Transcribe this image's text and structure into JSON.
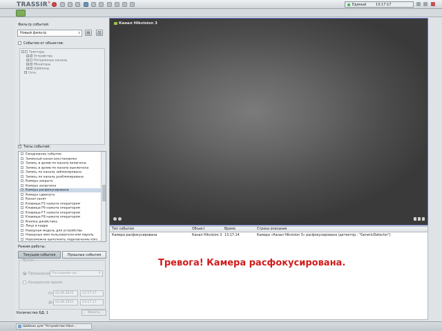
{
  "app": {
    "logo": "TRASSIR",
    "logo_mark": "®"
  },
  "topbar": {
    "status_label": "Единый",
    "time": "13:17:17"
  },
  "filter": {
    "label": "Фильтр событий:",
    "selected": "Новый фильтр",
    "objects_checkbox": "События от объектов:",
    "tree": [
      {
        "label": "Триггеры",
        "checked": false,
        "indent": 1
      },
      {
        "label": "Устройства",
        "checked": true,
        "indent": 2
      },
      {
        "label": "Потерянные каналы",
        "checked": false,
        "indent": 2
      },
      {
        "label": "Мониторы",
        "checked": true,
        "indent": 2
      },
      {
        "label": "Шаблоны",
        "checked": true,
        "indent": 2
      },
      {
        "label": "Сеть",
        "checked": true,
        "indent": 1
      }
    ]
  },
  "event_types": {
    "label": "Типы событий:",
    "items": [
      {
        "label": "Ежедневное событие",
        "selected": false
      },
      {
        "label": "Записный канал восстановлен",
        "selected": false
      },
      {
        "label": "Запись в архив по каналу включена",
        "selected": false
      },
      {
        "label": "Запись в архив по каналу выключена",
        "selected": false
      },
      {
        "label": "Запись по каналу заблокирована",
        "selected": false
      },
      {
        "label": "Запись по каналу разблокирована",
        "selected": false
      },
      {
        "label": "Камера закрыта",
        "selected": false
      },
      {
        "label": "Камера засвечена",
        "selected": false
      },
      {
        "label": "Камера расфокусирована",
        "selected": true
      },
      {
        "label": "Камера сдвинута",
        "selected": false
      },
      {
        "label": "Канал занят",
        "selected": false
      },
      {
        "label": "Клавиша F5 нажата оператором",
        "selected": false
      },
      {
        "label": "Клавиша F6 нажата оператором",
        "selected": false
      },
      {
        "label": "Клавиша F7 нажата оператором",
        "selected": false
      },
      {
        "label": "Клавиша F8 нажата оператором",
        "selected": false
      },
      {
        "label": "Кнопка джойстика",
        "selected": false
      },
      {
        "label": "Лицо в кадре",
        "selected": false
      },
      {
        "label": "Неверная модель для устройства",
        "selected": false
      },
      {
        "label": "Неверные имя пользователя или пароль",
        "selected": false
      },
      {
        "label": "Невозможно выполнить подключение к/из...",
        "selected": false
      }
    ]
  },
  "mode": {
    "label": "Режим работы:",
    "tab_current": "Текущие события",
    "tab_past": "Прошлые события"
  },
  "time": {
    "label": "Время",
    "option_recent": "Предыдущие",
    "recent_value": "Последний час",
    "option_range": "Конкретное время",
    "from_label": "От:",
    "to_label": "До:",
    "from_date": "02.06.2015",
    "from_time": "12:17:17",
    "to_date": "02.06.2015",
    "to_time": "13:17:17"
  },
  "db": {
    "count_label": "Количество БД: 1",
    "reset_label": "Искать"
  },
  "video": {
    "camera_title": "Канал Hikvision 3"
  },
  "table": {
    "headers": [
      "Тип события",
      "Объект",
      "Время",
      "Строка описания"
    ],
    "rows": [
      [
        "Камера расфокусирована",
        "Канал Hikvision 3",
        "13:17:14",
        "Камера «Канал Hikvision 3» расфокусирована (детектор : \"GenericDetector\")"
      ]
    ],
    "alarm": "Тревога! Камера расфокусирована."
  },
  "taskbar": {
    "item": "Шаблон для \"Устройство Hikvi..."
  },
  "colors": {
    "alarm": "#d11a1a",
    "accent_frame": "#6a72c8",
    "selected_row": "#c9d8e8"
  }
}
